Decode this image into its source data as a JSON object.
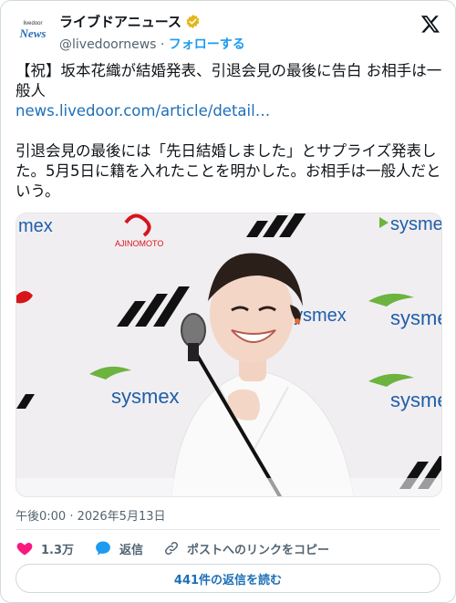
{
  "account": {
    "logo_small": "livedoor",
    "logo_big": "News",
    "name": "ライブドアニュース",
    "handle": "@livedoornews",
    "separator": "·",
    "follow_label": "フォローする"
  },
  "post": {
    "headline": "【祝】坂本花織が結婚発表、引退会見の最後に告白 お相手は一般人",
    "link": "news.livedoor.com/article/detail…",
    "body": "引退会見の最後には「先日結婚しました」とサプライズ発表した。5月5日に籍を入れたことを明かした。お相手は一般人だという。"
  },
  "photo": {
    "backdrop_text": [
      "sysmex",
      "sysmex",
      "sysmex",
      "sysmex",
      "sysmex",
      "mex",
      "AJINOMOTO"
    ],
    "colors": {
      "sysmex_blue": "#1e5fa8",
      "sysmex_green": "#6cb33f",
      "ajinomoto_red": "#d7141a"
    }
  },
  "meta": {
    "timestamp": "午後0:00 · 2026年5月13日"
  },
  "actions": {
    "like_count": "1.3万",
    "reply_label": "返信",
    "copy_label": "ポストへのリンクをコピー",
    "icons": {
      "like": "heart-icon",
      "reply": "speech-bubble-icon",
      "copy": "link-icon"
    }
  },
  "read_replies": "441件の返信を読む",
  "colors": {
    "accent": "#1d9bf0",
    "like": "#f91880",
    "verified": "#e2b719"
  }
}
